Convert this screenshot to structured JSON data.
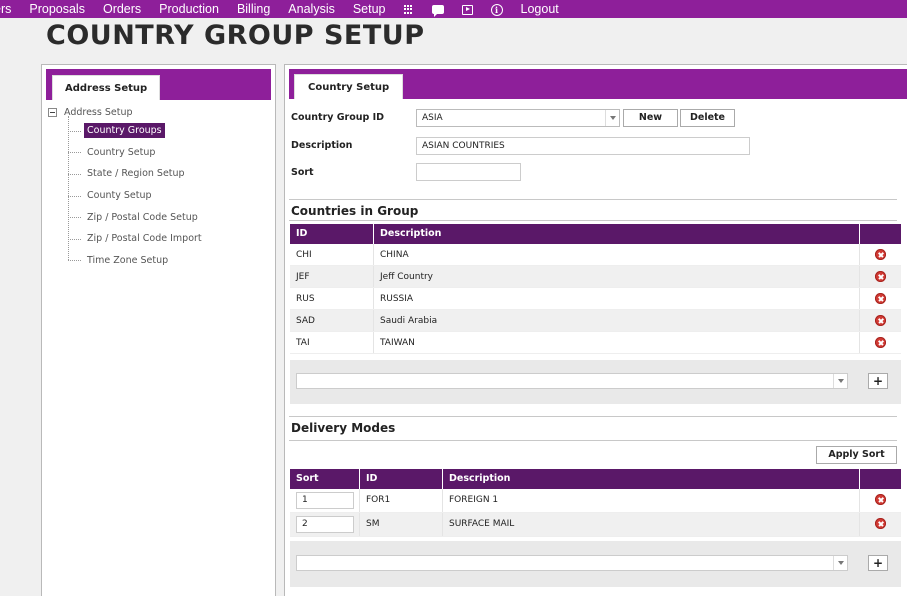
{
  "nav": {
    "items": [
      "ers",
      "Proposals",
      "Orders",
      "Production",
      "Billing",
      "Analysis",
      "Setup"
    ],
    "icons": [
      "grid-icon",
      "chat-icon",
      "media-icon",
      "info-icon"
    ],
    "logout": "Logout",
    "accent": "#8e1f9a"
  },
  "page": {
    "title": "COUNTRY GROUP SETUP"
  },
  "left": {
    "tab": "Address Setup",
    "root": "Address Setup",
    "items": [
      {
        "label": "Country Groups",
        "selected": true
      },
      {
        "label": "Country Setup"
      },
      {
        "label": "State / Region Setup"
      },
      {
        "label": "County Setup"
      },
      {
        "label": "Zip / Postal Code Setup"
      },
      {
        "label": "Zip / Postal Code Import"
      },
      {
        "label": "Time Zone Setup"
      }
    ]
  },
  "form": {
    "tab": "Country Setup",
    "group_id_label": "Country Group ID",
    "group_id_value": "ASIA",
    "new_label": "New",
    "delete_label": "Delete",
    "description_label": "Description",
    "description_value": "ASIAN COUNTRIES",
    "sort_label": "Sort",
    "sort_value": ""
  },
  "countries": {
    "title": "Countries in Group",
    "headers": [
      "ID",
      "Description"
    ],
    "rows": [
      {
        "id": "CHI",
        "description": "CHINA"
      },
      {
        "id": "JEF",
        "description": "Jeff Country"
      },
      {
        "id": "RUS",
        "description": "RUSSIA"
      },
      {
        "id": "SAD",
        "description": "Saudi Arabia"
      },
      {
        "id": "TAI",
        "description": "TAIWAN"
      }
    ],
    "add_label": "+"
  },
  "delivery": {
    "title": "Delivery Modes",
    "apply_sort_label": "Apply Sort",
    "headers": [
      "Sort",
      "ID",
      "Description"
    ],
    "rows": [
      {
        "sort": "1",
        "id": "FOR1",
        "description": "FOREIGN 1"
      },
      {
        "sort": "2",
        "id": "SM",
        "description": "SURFACE MAIL"
      }
    ],
    "add_label": "+"
  }
}
